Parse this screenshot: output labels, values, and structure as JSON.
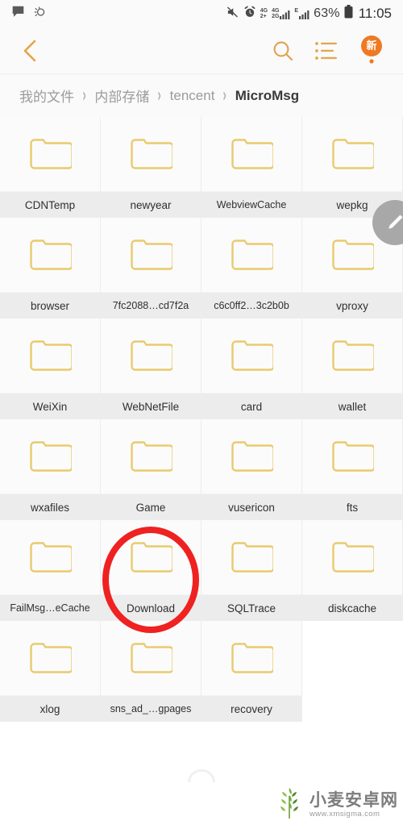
{
  "status_bar": {
    "left_icons": [
      "message-icon",
      "weather-icon"
    ],
    "mute_icon": "mute-icon",
    "alarm_icon": "alarm-icon",
    "signal_1_label": "4G",
    "signal_1_sub": "2+",
    "signal_2_label": "4G",
    "signal_2_sub": "2G",
    "signal_3_label": "E",
    "battery_percent": "63%",
    "battery_icon": "battery-icon",
    "time": "11:05"
  },
  "nav_bar": {
    "back_icon": "back-chevron-icon",
    "search_icon": "search-icon",
    "list_icon": "list-view-icon",
    "badge_icon": "new-badge-icon",
    "badge_label": "新"
  },
  "breadcrumb": {
    "separator": "›",
    "items": [
      {
        "label": "我的文件",
        "current": false
      },
      {
        "label": "内部存储",
        "current": false
      },
      {
        "label": "tencent",
        "current": false
      },
      {
        "label": "MicroMsg",
        "current": true
      }
    ]
  },
  "fab": {
    "icon": "edit-pencil-icon"
  },
  "grid": {
    "folder_icon": "folder-icon",
    "items": [
      {
        "label": "CDNTemp",
        "highlighted": false
      },
      {
        "label": "newyear",
        "highlighted": false
      },
      {
        "label": "WebviewCache",
        "highlighted": false
      },
      {
        "label": "wepkg",
        "highlighted": false
      },
      {
        "label": "browser",
        "highlighted": false
      },
      {
        "label": "7fc2088…cd7f2a",
        "highlighted": false
      },
      {
        "label": "c6c0ff2…3c2b0b",
        "highlighted": false
      },
      {
        "label": "vproxy",
        "highlighted": false
      },
      {
        "label": "WeiXin",
        "highlighted": false
      },
      {
        "label": "WebNetFile",
        "highlighted": false
      },
      {
        "label": "card",
        "highlighted": false
      },
      {
        "label": "wallet",
        "highlighted": false
      },
      {
        "label": "wxafiles",
        "highlighted": false
      },
      {
        "label": "Game",
        "highlighted": false
      },
      {
        "label": "vusericon",
        "highlighted": false
      },
      {
        "label": "fts",
        "highlighted": false
      },
      {
        "label": "FailMsg…eCache",
        "highlighted": false
      },
      {
        "label": "Download",
        "highlighted": true
      },
      {
        "label": "SQLTrace",
        "highlighted": false
      },
      {
        "label": "diskcache",
        "highlighted": false
      },
      {
        "label": "xlog",
        "highlighted": false
      },
      {
        "label": "sns_ad_…gpages",
        "highlighted": false
      },
      {
        "label": "recovery",
        "highlighted": false
      }
    ]
  },
  "annotation": {
    "shape": "red-ellipse",
    "color": "#ef2121",
    "targets": "Download"
  },
  "watermark": {
    "logo": "wheat-logo-icon",
    "title": "小麦安卓网",
    "url": "www.xmsigma.com"
  },
  "colors": {
    "folder_outline": "#e9ca6e",
    "accent_orange": "#f0a13c",
    "annotation_red": "#ef2121",
    "label_band": "#ececec"
  }
}
